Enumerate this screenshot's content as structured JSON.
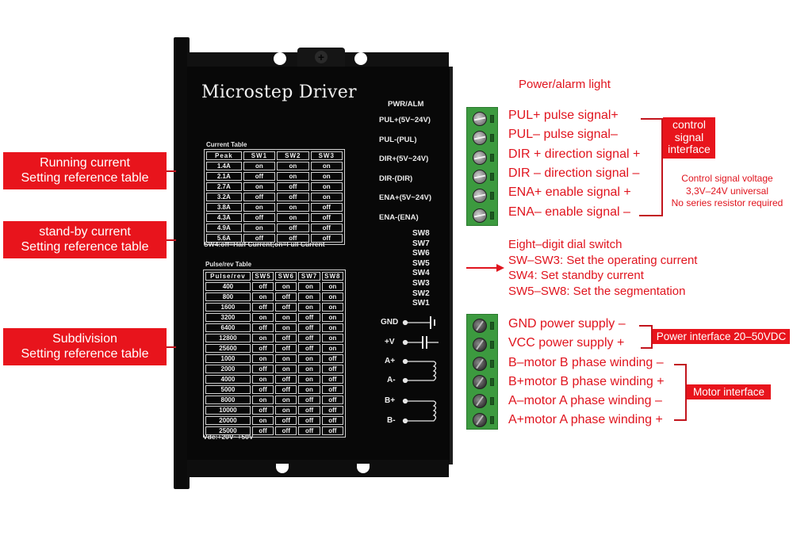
{
  "device": {
    "title": "Microstep Driver",
    "current_table": {
      "caption": "Current Table",
      "headers": [
        "Peak",
        "SW1",
        "SW2",
        "SW3"
      ],
      "rows": [
        [
          "1.4A",
          "on",
          "on",
          "on"
        ],
        [
          "2.1A",
          "off",
          "on",
          "on"
        ],
        [
          "2.7A",
          "on",
          "off",
          "on"
        ],
        [
          "3.2A",
          "off",
          "off",
          "on"
        ],
        [
          "3.8A",
          "on",
          "on",
          "off"
        ],
        [
          "4.3A",
          "off",
          "on",
          "off"
        ],
        [
          "4.9A",
          "on",
          "off",
          "off"
        ],
        [
          "5.6A",
          "off",
          "off",
          "off"
        ]
      ],
      "note": "SW4:off=Half Current;on=Full Current"
    },
    "pulse_table": {
      "caption": "Pulse/rev Table",
      "headers": [
        "Pulse/rev",
        "SW5",
        "SW6",
        "SW7",
        "SW8"
      ],
      "rows": [
        [
          "400",
          "off",
          "on",
          "on",
          "on"
        ],
        [
          "800",
          "on",
          "off",
          "on",
          "on"
        ],
        [
          "1600",
          "off",
          "off",
          "on",
          "on"
        ],
        [
          "3200",
          "on",
          "on",
          "off",
          "on"
        ],
        [
          "6400",
          "off",
          "on",
          "off",
          "on"
        ],
        [
          "12800",
          "on",
          "off",
          "off",
          "on"
        ],
        [
          "25600",
          "off",
          "off",
          "off",
          "on"
        ],
        [
          "1000",
          "on",
          "on",
          "on",
          "off"
        ],
        [
          "2000",
          "off",
          "on",
          "on",
          "off"
        ],
        [
          "4000",
          "on",
          "off",
          "on",
          "off"
        ],
        [
          "5000",
          "off",
          "off",
          "on",
          "off"
        ],
        [
          "8000",
          "on",
          "on",
          "off",
          "off"
        ],
        [
          "10000",
          "off",
          "on",
          "off",
          "off"
        ],
        [
          "20000",
          "on",
          "off",
          "off",
          "off"
        ],
        [
          "25000",
          "off",
          "off",
          "off",
          "off"
        ]
      ]
    },
    "vdc_note": "Vdc:+20V~+50V",
    "pwr_label": "PWR/ALM",
    "signal_terminals": [
      "PUL+(5V~24V)",
      "PUL-(PUL)",
      "DIR+(5V~24V)",
      "DIR-(DIR)",
      "ENA+(5V~24V)",
      "ENA-(ENA)"
    ],
    "switches": [
      "SW8",
      "SW7",
      "SW6",
      "SW5",
      "SW4",
      "SW3",
      "SW2",
      "SW1"
    ],
    "power_terminals": [
      "GND",
      "+V",
      "A+",
      "A-",
      "B+",
      "B-"
    ]
  },
  "left_labels": [
    {
      "line1": "Running current",
      "line2": "Setting reference table"
    },
    {
      "line1": "stand-by current",
      "line2": "Setting reference table"
    },
    {
      "line1": "Subdivision",
      "line2": "Setting reference table"
    }
  ],
  "right": {
    "power_light": "Power/alarm light",
    "signal_pins": [
      "PUL+ pulse signal+",
      "PUL– pulse signal–",
      "DIR + direction signal +",
      "DIR – direction signal –",
      "ENA+ enable signal +",
      "ENA– enable signal –"
    ],
    "control_box": [
      "control",
      "signal",
      "interface"
    ],
    "control_note": [
      "Control signal voltage",
      "3,3V–24V universal",
      "No series resistor required"
    ],
    "switch_desc": [
      "Eight–digit dial switch",
      "SW–SW3: Set the operating current",
      "SW4: Set standby current",
      "SW5–SW8: Set the segmentation"
    ],
    "power_pins": [
      "GND power supply –",
      "VCC power supply +"
    ],
    "power_box": "Power interface 20–50VDC",
    "motor_pins": [
      "B–motor B phase winding –",
      "B+motor B phase winding +",
      "A–motor A phase winding –",
      "A+motor A phase winding +"
    ],
    "motor_box": "Motor interface"
  },
  "colors": {
    "accent_red": "#e8141c",
    "terminal_green": "#3c9a3f",
    "device_black": "#080808"
  }
}
